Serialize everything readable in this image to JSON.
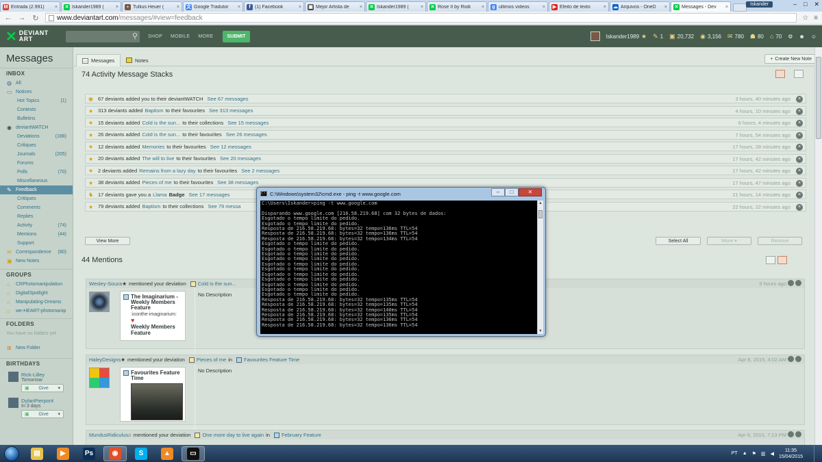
{
  "browser": {
    "tabs": [
      {
        "label": "Entrada (2.991)",
        "icon": "gmail-icon",
        "color": "#d44638",
        "glyph": "M"
      },
      {
        "label": "Iskander1989 (",
        "icon": "deviantart-icon",
        "color": "#05cc47",
        "glyph": "✕"
      },
      {
        "label": "Tullius Heuer (",
        "icon": "deviantart-icon",
        "color": "#7a5a45",
        "glyph": "▪"
      },
      {
        "label": "Google Tradutor",
        "icon": "google-translate-icon",
        "color": "#4285f4",
        "glyph": "文"
      },
      {
        "label": "(1) Facebook",
        "icon": "facebook-icon",
        "color": "#3b5998",
        "glyph": "f"
      },
      {
        "label": "Mejor Artista de",
        "icon": "page-icon",
        "color": "#444444",
        "glyph": "▣"
      },
      {
        "label": "Iskander1989 (",
        "icon": "deviantart-icon",
        "color": "#05cc47",
        "glyph": "✕"
      },
      {
        "label": "Rose II by Rodi",
        "icon": "deviantart-icon",
        "color": "#05cc47",
        "glyph": "✕"
      },
      {
        "label": "ultimos vídeos",
        "icon": "google-icon",
        "color": "#4285f4",
        "glyph": "g"
      },
      {
        "label": "Efeito de texto",
        "icon": "youtube-icon",
        "color": "#e62117",
        "glyph": "▶"
      },
      {
        "label": "Arquivos - OneD",
        "icon": "onedrive-icon",
        "color": "#0a64c8",
        "glyph": "☁"
      },
      {
        "label": "Messages - Dev",
        "icon": "deviantart-icon",
        "color": "#05cc47",
        "glyph": "✕",
        "active": true
      }
    ],
    "window_user": "Iskander",
    "url_host": "www.deviantart.com",
    "url_path": "/messages/#view=feedback"
  },
  "header": {
    "logo_line1": "DEVIANT",
    "logo_line2": "ART",
    "nav": [
      "SHOP",
      "MOBILE",
      "MORE"
    ],
    "submit_label": "SUBMIT",
    "username": "Iskander1989",
    "stats": {
      "notes": "1",
      "points": "20,732",
      "watchers": "3,156",
      "comments": "780",
      "deviations": "80",
      "home": "70"
    }
  },
  "sidebar": {
    "title": "Messages",
    "inbox_head": "INBOX",
    "inbox": [
      {
        "label": "All",
        "level": 0,
        "count": ""
      },
      {
        "label": "Notices",
        "level": 0,
        "count": ""
      },
      {
        "label": "Hot Topics",
        "level": 1,
        "count": "(1)"
      },
      {
        "label": "Contests",
        "level": 1,
        "count": ""
      },
      {
        "label": "Bulletins",
        "level": 1,
        "count": ""
      },
      {
        "label": "deviantWATCH",
        "level": 0,
        "count": ""
      },
      {
        "label": "Deviations",
        "level": 1,
        "count": "(188)"
      },
      {
        "label": "Critiques",
        "level": 1,
        "count": ""
      },
      {
        "label": "Journals",
        "level": 1,
        "count": "(205)"
      },
      {
        "label": "Forums",
        "level": 1,
        "count": ""
      },
      {
        "label": "Polls",
        "level": 1,
        "count": "(70)"
      },
      {
        "label": "Miscellaneous",
        "level": 1,
        "count": ""
      },
      {
        "label": "Feedback",
        "level": 0,
        "count": "",
        "active": true
      },
      {
        "label": "Critiques",
        "level": 1,
        "count": ""
      },
      {
        "label": "Comments",
        "level": 1,
        "count": ""
      },
      {
        "label": "Replies",
        "level": 1,
        "count": ""
      },
      {
        "label": "Activity",
        "level": 1,
        "count": "(74)"
      },
      {
        "label": "Mentions",
        "level": 1,
        "count": "(44)"
      },
      {
        "label": "Support",
        "level": 1,
        "count": ""
      },
      {
        "label": "Correspondence",
        "level": 0,
        "count": "(80)"
      },
      {
        "label": "New Notes",
        "level": 0,
        "count": ""
      }
    ],
    "groups_head": "GROUPS",
    "groups": [
      "CRPhotomanipulation",
      "DigitalSpotlight",
      "Manipulating-Dreams",
      "we-HEART-photomanip"
    ],
    "folders_head": "FOLDERS",
    "no_folders": "You have no folders yet",
    "new_folder": "New Folder",
    "birthdays_head": "BIRTHDAYS",
    "birthdays": [
      {
        "name": "Rick-Lilley",
        "when": "Tomorrow",
        "give": "Give"
      },
      {
        "name": "DylanPierpont",
        "when": "In 3 days",
        "give": "Give"
      }
    ]
  },
  "main": {
    "tabs": [
      "Messages",
      "Notes"
    ],
    "create_note": "Create New Note",
    "activity_title": "74 Activity Message Stacks",
    "activity": [
      {
        "count": "67 deviants added you to their deviantWATCH",
        "link": "",
        "suffix": "",
        "see": "See 67 messages",
        "time": "3 hours, 40 minutes ago",
        "icon": "watch-icon"
      },
      {
        "count": "313 deviants added",
        "link": "Baptism",
        "suffix": "to their favourites",
        "see": "See 313 messages",
        "time": "4 hours, 10 minutes ago",
        "icon": "star-icon"
      },
      {
        "count": "15 deviants added",
        "link": "Cold is the sun...",
        "suffix": "to their collections",
        "see": "See 15 messages",
        "time": "6 hours, 4 minutes ago",
        "icon": "star-icon"
      },
      {
        "count": "26 deviants added",
        "link": "Cold is the sun...",
        "suffix": "to their favourites",
        "see": "See 26 messages",
        "time": "7 hours, 54 minutes ago",
        "icon": "star-icon"
      },
      {
        "count": "12 deviants added",
        "link": "Memories",
        "suffix": "to their favourites",
        "see": "See 12 messages",
        "time": "17 hours, 28 minutes ago",
        "icon": "star-icon"
      },
      {
        "count": "20 deviants added",
        "link": "The will to live",
        "suffix": "to their favourites",
        "see": "See 20 messages",
        "time": "17 hours, 42 minutes ago",
        "icon": "star-icon"
      },
      {
        "count": "2 deviants added",
        "link": "Remains from a lazy day",
        "suffix": "to their favourites",
        "see": "See 2 messages",
        "time": "17 hours, 42 minutes ago",
        "icon": "star-icon"
      },
      {
        "count": "38 deviants added",
        "link": "Pieces of me",
        "suffix": "to their favourites",
        "see": "See 38 messages",
        "time": "17 hours, 47 minutes ago",
        "icon": "star-icon"
      },
      {
        "count": "17 deviants gave you a",
        "link": "Llama",
        "suffix": "Badge",
        "see": "See 17 messages",
        "time": "21 hours, 14 minutes ago",
        "icon": "llama-icon"
      },
      {
        "count": "79 deviants added",
        "link": "Baptism",
        "suffix": "to their collections",
        "see": "See 79 messa",
        "time": "22 hours, 22 minutes ago",
        "icon": "star-icon"
      }
    ],
    "view_more": "View More",
    "select_all": "Select All",
    "move": "Move ▾",
    "remove": "Remove",
    "mentions_title": "44 Mentions",
    "mentions": [
      {
        "user": "Wesley-Souza",
        "user_suffix": "★",
        "action": "mentioned your deviation",
        "deviation": "Cold is the sun...",
        "in_word": "",
        "feature": "",
        "time": "9 hours ago",
        "thumb_title": "The Imaginarium - Weekly Members Feature",
        "thumb_sub": ":iconthe-imaginarium:",
        "thumb_heart": "♥",
        "thumb_sub2": "Weekly Members Feature",
        "desc": "No Description"
      },
      {
        "user": "HaleyDesigns",
        "user_suffix": "★",
        "action": "mentioned your deviation",
        "deviation": "Pieces of me",
        "in_word": "in",
        "feature": "Favourites Feature Time",
        "time": "Apr 8, 2015, 4:02 AM",
        "thumb_title": "Favourites Feature Time",
        "thumb_sub": "",
        "thumb_heart": "",
        "thumb_sub2": "",
        "desc": "No Description"
      },
      {
        "user": "MundusRidiculus",
        "user_suffix": "⌂",
        "action": "mentioned your deviation",
        "deviation": "One more day to live again",
        "in_word": "in",
        "feature": "February Feature",
        "time": "Apr 6, 2015, 7:13 PM",
        "thumb_title": "",
        "thumb_sub": "",
        "thumb_heart": "",
        "thumb_sub2": "",
        "desc": ""
      }
    ]
  },
  "cmd": {
    "title": "C:\\Windows\\system32\\cmd.exe - ping  -t www.google.com",
    "lines": [
      "C:\\Users\\Iskander>ping -t www.google.com",
      "",
      "Disparando www.google.com [216.58.219.68] com 32 bytes de dados:",
      "Esgotado o tempo limite do pedido.",
      "Esgotado o tempo limite do pedido.",
      "Resposta de 216.58.219.68: bytes=32 tempo=136ms TTL=54",
      "Resposta de 216.58.219.68: bytes=32 tempo=136ms TTL=54",
      "Resposta de 216.58.219.68: bytes=32 tempo=134ms TTL=54",
      "Esgotado o tempo limite do pedido.",
      "Esgotado o tempo limite do pedido.",
      "Esgotado o tempo limite do pedido.",
      "Esgotado o tempo limite do pedido.",
      "Esgotado o tempo limite do pedido.",
      "Esgotado o tempo limite do pedido.",
      "Esgotado o tempo limite do pedido.",
      "Esgotado o tempo limite do pedido.",
      "Esgotado o tempo limite do pedido.",
      "Esgotado o tempo limite do pedido.",
      "Esgotado o tempo limite do pedido.",
      "Resposta de 216.58.219.68: bytes=32 tempo=135ms TTL=54",
      "Resposta de 216.58.219.68: bytes=32 tempo=135ms TTL=54",
      "Resposta de 216.58.219.68: bytes=32 tempo=140ms TTL=54",
      "Resposta de 216.58.219.68: bytes=32 tempo=135ms TTL=54",
      "Resposta de 216.58.219.68: bytes=32 tempo=136ms TTL=54",
      "Resposta de 216.58.219.68: bytes=32 tempo=136ms TTL=54"
    ]
  },
  "taskbar": {
    "apps": [
      {
        "name": "explorer",
        "glyph": "▤",
        "color": "#e8c34a",
        "active": false
      },
      {
        "name": "media-player",
        "glyph": "▶",
        "color": "#f08a24",
        "active": false
      },
      {
        "name": "photoshop",
        "glyph": "Ps",
        "color": "#0c2f57",
        "active": false
      },
      {
        "name": "chrome",
        "glyph": "◉",
        "color": "#e44d26",
        "active": true
      },
      {
        "name": "skype",
        "glyph": "S",
        "color": "#00aff0",
        "active": false
      },
      {
        "name": "vlc",
        "glyph": "▲",
        "color": "#f08a24",
        "active": false
      },
      {
        "name": "cmd",
        "glyph": "▭",
        "color": "#111111",
        "active": true
      }
    ],
    "lang": "PT",
    "time": "11:35",
    "date": "15/04/2015"
  }
}
